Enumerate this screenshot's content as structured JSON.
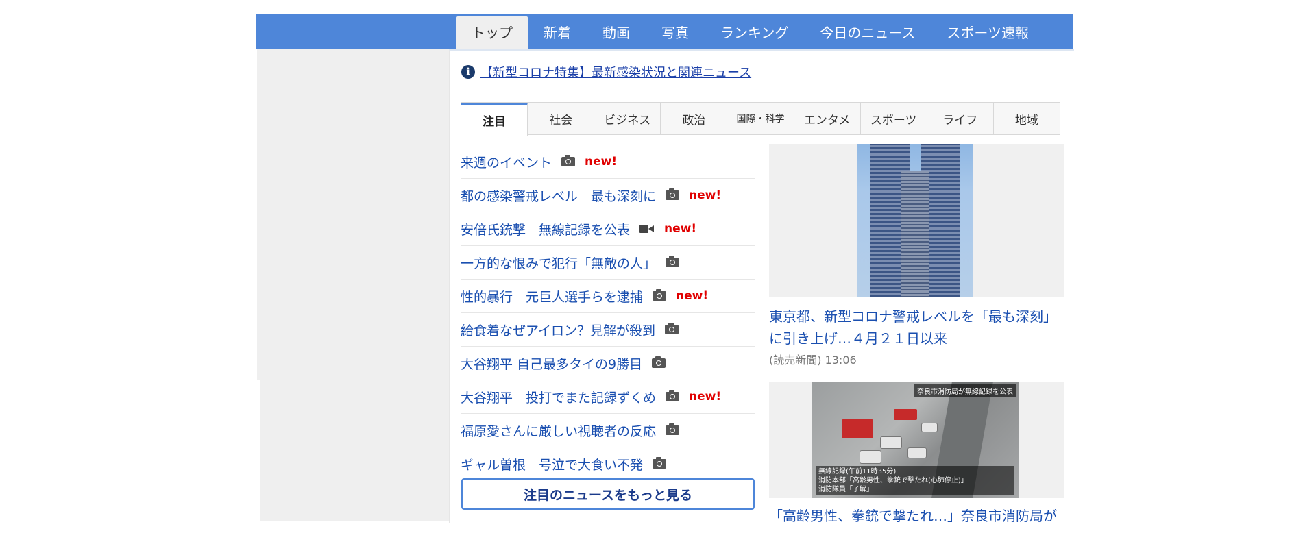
{
  "nav": {
    "tabs": [
      "トップ",
      "新着",
      "動画",
      "写真",
      "ランキング",
      "今日のニュース",
      "スポーツ速報"
    ],
    "active": 0
  },
  "notice": {
    "text": "【新型コロナ特集】最新感染状況と関連ニュース",
    "icon": "info-icon"
  },
  "categories": {
    "tabs": [
      "注目",
      "社会",
      "ビジネス",
      "政治",
      "国際・科学",
      "エンタメ",
      "スポーツ",
      "ライフ",
      "地域"
    ],
    "active": 0
  },
  "news": [
    {
      "title": "来週のイベント",
      "media": "camera-icon",
      "new_label": "new!"
    },
    {
      "title": "都の感染警戒レベル　最も深刻に",
      "media": "camera-icon",
      "new_label": "new!"
    },
    {
      "title": "安倍氏銃撃　無線記録を公表",
      "media": "video-icon",
      "new_label": "new!"
    },
    {
      "title": "一方的な恨みで犯行「無敵の人」",
      "media": "camera-icon",
      "new_label": ""
    },
    {
      "title": "性的暴行　元巨人選手らを逮捕",
      "media": "camera-icon",
      "new_label": "new!"
    },
    {
      "title": "給食着なぜアイロン？見解が殺到",
      "media": "camera-icon",
      "new_label": ""
    },
    {
      "title": "大谷翔平 自己最多タイの9勝目",
      "media": "camera-icon",
      "new_label": ""
    },
    {
      "title": "大谷翔平　投打でまた記録ずくめ",
      "media": "camera-icon",
      "new_label": "new!"
    },
    {
      "title": "福原愛さんに厳しい視聴者の反応",
      "media": "camera-icon",
      "new_label": ""
    },
    {
      "title": "ギャル曽根　号泣で大食い不発",
      "media": "camera-icon",
      "new_label": ""
    }
  ],
  "more_button": "注目のニュースをもっと見る",
  "features": [
    {
      "title": "東京都、新型コロナ警戒レベルを「最も深刻」に引き上げ…４月２１日以来",
      "source": "(読売新聞) 13:06"
    },
    {
      "title": "「高齢男性、拳銃で撃たれ…」奈良市消防局が",
      "image_tag": "奈良市消防局が無線記録を公表",
      "image_caption": [
        "無線記録(午前11時35分)",
        "消防本部「高齢男性、拳銃で撃たれ(心肺停止)」",
        "消防隊員「了解」"
      ]
    }
  ]
}
